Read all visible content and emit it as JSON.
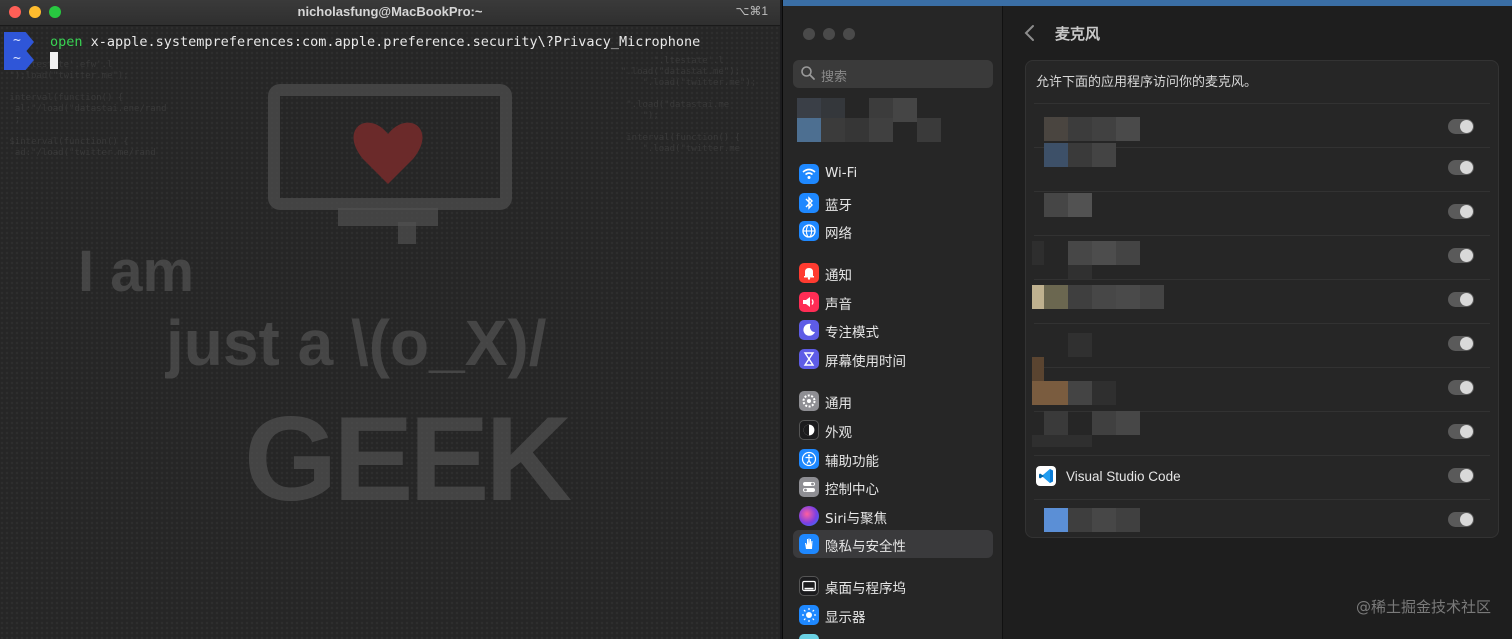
{
  "terminal": {
    "title": "nicholasfung@MacBookPro:~",
    "shortcut": "⌥⌘1",
    "prompt_glyph": "~",
    "command_keyword": "open",
    "command_args": " x-apple.systempreferences:com.apple.preference.security\\?Privacy_Microphone",
    "wallpaper": {
      "line1": "I am",
      "line2": "just a \\(o_X)/",
      "line3": "GEEK"
    }
  },
  "settings": {
    "search_placeholder": "搜索",
    "sidebar": {
      "items": [
        {
          "label": "Wi-Fi",
          "icon": "wifi-icon",
          "color": "#1e88ff"
        },
        {
          "label": "蓝牙",
          "icon": "bluetooth-icon",
          "color": "#1e88ff"
        },
        {
          "label": "网络",
          "icon": "globe-icon",
          "color": "#1e88ff"
        },
        {
          "label": "通知",
          "icon": "bell-icon",
          "color": "#ff3b30"
        },
        {
          "label": "声音",
          "icon": "speaker-icon",
          "color": "#ff2d55"
        },
        {
          "label": "专注模式",
          "icon": "moon-icon",
          "color": "#5e5ce6"
        },
        {
          "label": "屏幕使用时间",
          "icon": "hourglass-icon",
          "color": "#5e5ce6"
        },
        {
          "label": "通用",
          "icon": "gear-icon",
          "color": "#8e8e93"
        },
        {
          "label": "外观",
          "icon": "appearance-icon",
          "color": "#1c1c1e"
        },
        {
          "label": "辅助功能",
          "icon": "accessibility-icon",
          "color": "#1e88ff"
        },
        {
          "label": "控制中心",
          "icon": "control-center-icon",
          "color": "#8e8e93"
        },
        {
          "label": "Siri与聚焦",
          "icon": "siri-icon",
          "color": "#7b3fe4"
        },
        {
          "label": "隐私与安全性",
          "icon": "hand-icon",
          "color": "#1e88ff"
        },
        {
          "label": "桌面与程序坞",
          "icon": "dock-icon",
          "color": "#1c1c1e"
        },
        {
          "label": "显示器",
          "icon": "display-icon",
          "color": "#1e88ff"
        }
      ],
      "active": "隐私与安全性"
    },
    "main": {
      "title": "麦克风",
      "description": "允许下面的应用程序访问你的麦克风。",
      "named_app": "Visual Studio Code",
      "toggle_count_note": "10 apps listed, all toggles off"
    }
  },
  "watermark": "@稀土掘金技术社区"
}
